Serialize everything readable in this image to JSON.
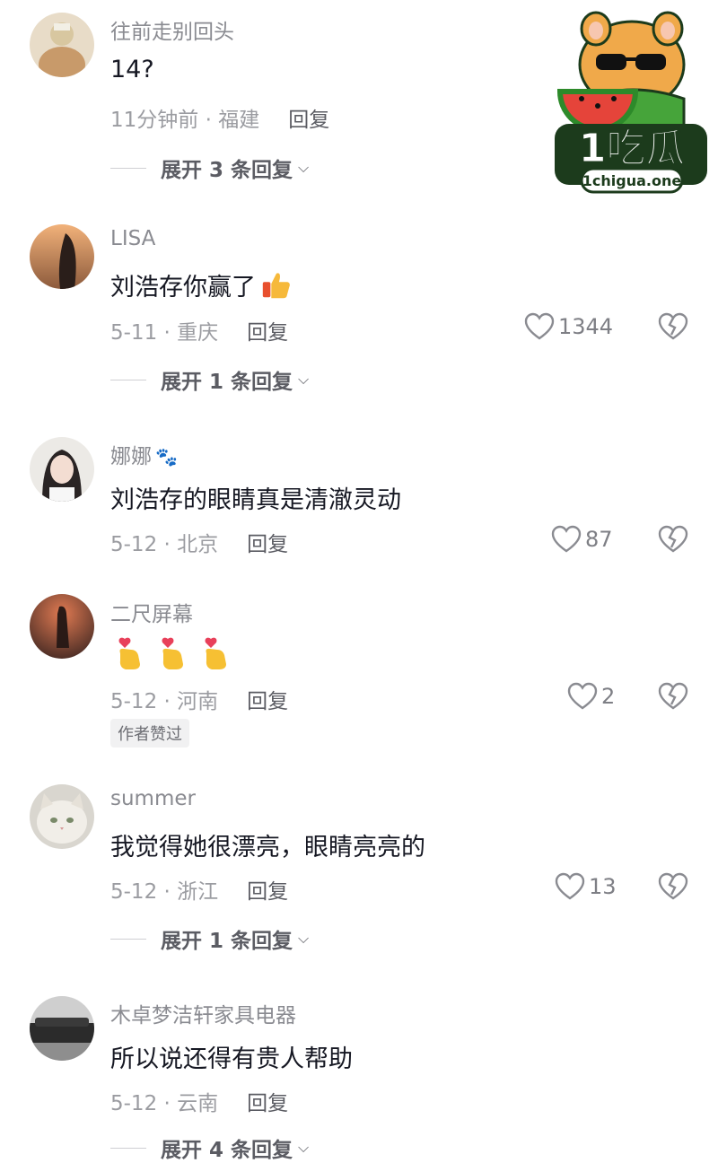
{
  "reply_label": "回复",
  "watermark": {
    "brand": "1吃瓜",
    "domain": "1chigua.one"
  },
  "comments": [
    {
      "username": "往前走别回头",
      "text": "14?",
      "date_location": "11分钟前 · 福建",
      "expand": "展开 3 条回复"
    },
    {
      "username": "LISA",
      "text": "刘浩存你赢了",
      "date_location": "5-11 · 重庆",
      "likes": "1344",
      "expand": "展开 1 条回复"
    },
    {
      "username": "娜娜",
      "text": "刘浩存的眼睛真是清澈灵动",
      "date_location": "5-12 · 北京",
      "likes": "87"
    },
    {
      "username": "二尺屏幕",
      "text": "",
      "date_location": "5-12 · 河南",
      "likes": "2",
      "badge": "作者赞过"
    },
    {
      "username": "summer",
      "text": "我觉得她很漂亮，眼睛亮亮的",
      "date_location": "5-12 · 浙江",
      "likes": "13",
      "expand": "展开 1 条回复"
    },
    {
      "username": "木卓梦洁轩家具电器",
      "text": "所以说还得有贵人帮助",
      "date_location": "5-12 · 云南",
      "expand": "展开 4 条回复"
    }
  ],
  "icons": {
    "like": "heart-outline-icon",
    "dislike": "broken-heart-icon",
    "expand": "chevron-down-icon",
    "thumbs_up": "thumbs-up-emoji",
    "finger_heart": "finger-heart-emoji",
    "paw": "paw-icon"
  }
}
